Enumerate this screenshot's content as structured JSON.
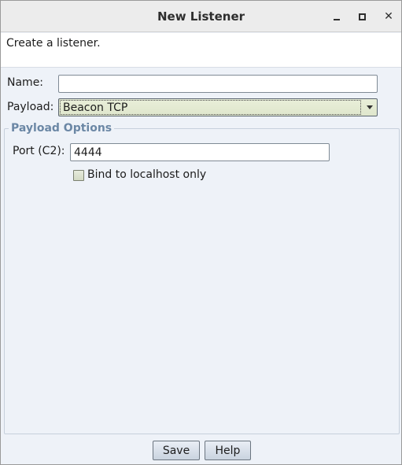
{
  "window": {
    "title": "New Listener",
    "controls": {
      "minimize_icon": "minimize-icon",
      "maximize_icon": "maximize-icon",
      "close_icon": "close-icon"
    }
  },
  "description": "Create a listener.",
  "form": {
    "name_label": "Name:",
    "name_value": "",
    "payload_label": "Payload:",
    "payload_selected": "Beacon TCP"
  },
  "payload_options": {
    "legend": "Payload Options",
    "port_label": "Port (C2):",
    "port_value": "4444",
    "bind_localhost_label": "Bind to localhost only",
    "bind_localhost_checked": false
  },
  "buttons": {
    "save": "Save",
    "help": "Help"
  },
  "colors": {
    "legend": "#6b87a5",
    "dialog_background": "#eef2f8",
    "select_background": "#dfe6cc"
  }
}
